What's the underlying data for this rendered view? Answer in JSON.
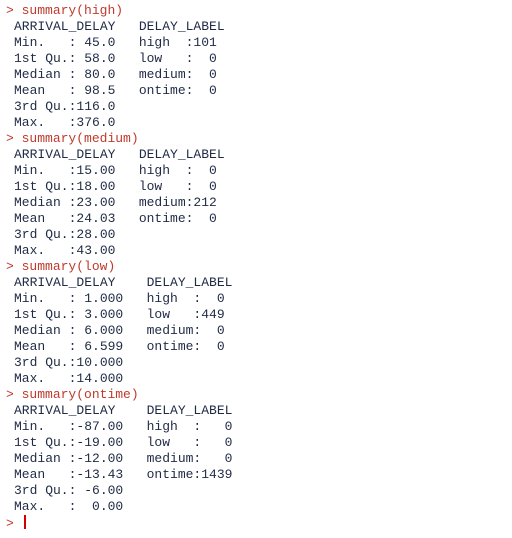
{
  "prompt": ">",
  "blocks": [
    {
      "command": "summary(high)",
      "lines": [
        "ARRIVAL_DELAY   DELAY_LABEL",
        "Min.   : 45.0   high  :101",
        "1st Qu.: 58.0   low   :  0",
        "Median : 80.0   medium:  0",
        "Mean   : 98.5   ontime:  0",
        "3rd Qu.:116.0",
        "Max.   :376.0"
      ]
    },
    {
      "command": "summary(medium)",
      "lines": [
        "ARRIVAL_DELAY   DELAY_LABEL",
        "Min.   :15.00   high  :  0",
        "1st Qu.:18.00   low   :  0",
        "Median :23.00   medium:212",
        "Mean   :24.03   ontime:  0",
        "3rd Qu.:28.00",
        "Max.   :43.00"
      ]
    },
    {
      "command": "summary(low)",
      "lines": [
        "ARRIVAL_DELAY    DELAY_LABEL",
        "Min.   : 1.000   high  :  0",
        "1st Qu.: 3.000   low   :449",
        "Median : 6.000   medium:  0",
        "Mean   : 6.599   ontime:  0",
        "3rd Qu.:10.000",
        "Max.   :14.000"
      ]
    },
    {
      "command": "summary(ontime)",
      "lines": [
        "ARRIVAL_DELAY    DELAY_LABEL",
        "Min.   :-87.00   high  :   0",
        "1st Qu.:-19.00   low   :   0",
        "Median :-12.00   medium:   0",
        "Mean   :-13.43   ontime:1439",
        "3rd Qu.: -6.00",
        "Max.   :  0.00"
      ]
    }
  ]
}
